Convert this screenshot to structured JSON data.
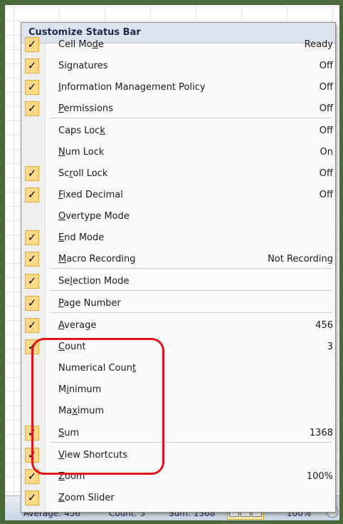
{
  "statusbar": {
    "average": "Average: 456",
    "count": "Count: 3",
    "sum": "Sum: 1368",
    "zoom": "100%"
  },
  "menu": {
    "title": "Customize Status Bar",
    "items": [
      {
        "label": "Cell Mode",
        "pre": "Cell Mo",
        "u": "d",
        "post": "e",
        "checked": true,
        "value": "Ready"
      },
      {
        "label": "Signatures",
        "pre": "Si",
        "u": "g",
        "post": "natures",
        "checked": true,
        "value": "Off"
      },
      {
        "label": "Information Management Policy",
        "pre": "",
        "u": "I",
        "post": "nformation Management Policy",
        "checked": true,
        "value": "Off"
      },
      {
        "label": "Permissions",
        "pre": "",
        "u": "P",
        "post": "ermissions",
        "checked": true,
        "value": "Off"
      },
      {
        "label": "Caps Lock",
        "pre": "Caps Loc",
        "u": "k",
        "post": "",
        "checked": false,
        "value": "Off"
      },
      {
        "label": "Num Lock",
        "pre": "",
        "u": "N",
        "post": "um Lock",
        "checked": false,
        "value": "On"
      },
      {
        "label": "Scroll Lock",
        "pre": "Sc",
        "u": "r",
        "post": "oll Lock",
        "checked": true,
        "value": "Off"
      },
      {
        "label": "Fixed Decimal",
        "pre": "",
        "u": "F",
        "post": "ixed Decimal",
        "checked": true,
        "value": "Off"
      },
      {
        "label": "Overtype Mode",
        "pre": "",
        "u": "O",
        "post": "vertype Mode",
        "checked": false,
        "value": ""
      },
      {
        "label": "End Mode",
        "pre": "",
        "u": "E",
        "post": "nd Mode",
        "checked": true,
        "value": ""
      },
      {
        "label": "Macro Recording",
        "pre": "",
        "u": "M",
        "post": "acro Recording",
        "checked": true,
        "value": "Not Recording"
      },
      {
        "label": "Selection Mode",
        "pre": "Se",
        "u": "l",
        "post": "ection Mode",
        "checked": true,
        "value": ""
      },
      {
        "label": "Page Number",
        "pre": "",
        "u": "P",
        "post": "age Number",
        "checked": true,
        "value": ""
      },
      {
        "label": "Average",
        "pre": "",
        "u": "A",
        "post": "verage",
        "checked": true,
        "value": "456"
      },
      {
        "label": "Count",
        "pre": "",
        "u": "C",
        "post": "ount",
        "checked": true,
        "value": "3"
      },
      {
        "label": "Numerical Count",
        "pre": "Numerical Coun",
        "u": "t",
        "post": "",
        "checked": false,
        "value": ""
      },
      {
        "label": "Minimum",
        "pre": "M",
        "u": "i",
        "post": "nimum",
        "checked": false,
        "value": ""
      },
      {
        "label": "Maximum",
        "pre": "Ma",
        "u": "x",
        "post": "imum",
        "checked": false,
        "value": ""
      },
      {
        "label": "Sum",
        "pre": "",
        "u": "S",
        "post": "um",
        "checked": true,
        "value": "1368"
      },
      {
        "label": "View Shortcuts",
        "pre": "",
        "u": "V",
        "post": "iew Shortcuts",
        "checked": true,
        "value": ""
      },
      {
        "label": "Zoom",
        "pre": "",
        "u": "Z",
        "post": "oom",
        "checked": true,
        "value": "100%"
      },
      {
        "label": "Zoom Slider",
        "pre": "",
        "u": "Z",
        "post": "oom Slider",
        "checked": true,
        "value": ""
      }
    ]
  },
  "colors": {
    "check_fill": "#fcd988",
    "check_border": "#e5a93a",
    "highlight": "#e0141a"
  }
}
